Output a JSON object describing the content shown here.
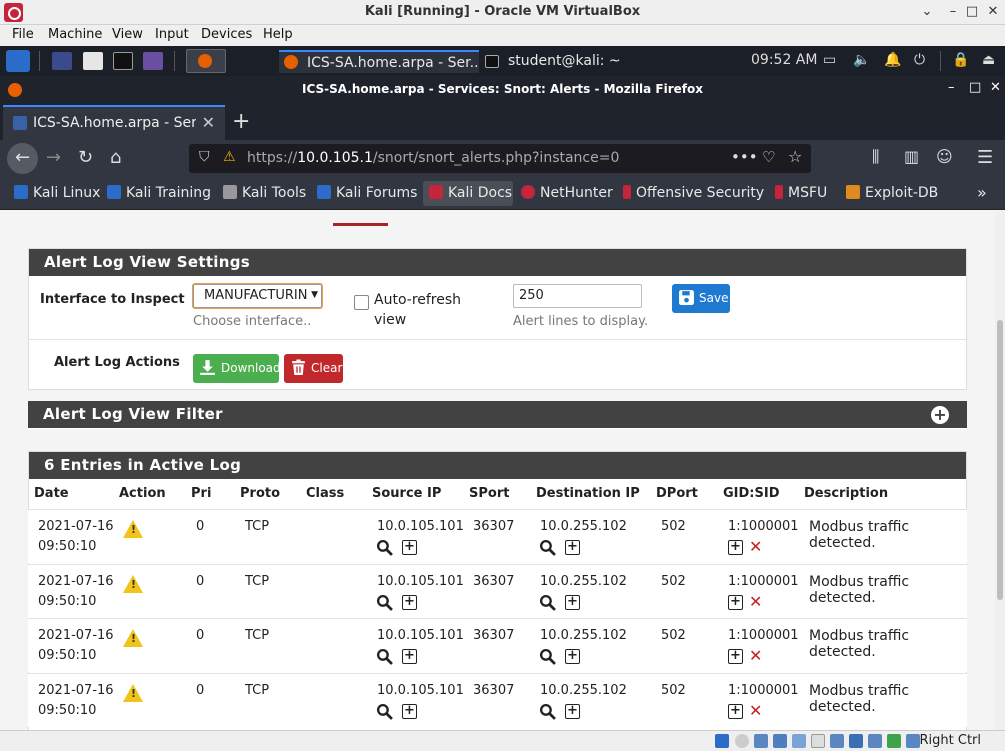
{
  "vbox": {
    "title": "Kali [Running] - Oracle VM VirtualBox",
    "menu": [
      "File",
      "Machine",
      "View",
      "Input",
      "Devices",
      "Help"
    ],
    "status_right": "Right Ctrl"
  },
  "taskbar": {
    "tasks": [
      "ICS-SA.home.arpa - Ser...",
      "student@kali: ~"
    ],
    "clock": "09:52 AM"
  },
  "firefox": {
    "window_title": "ICS-SA.home.arpa - Services: Snort: Alerts - Mozilla Firefox",
    "tab_label": "ICS-SA.home.arpa - Serv",
    "url_prefix": "https://",
    "url_host": "10.0.105.1",
    "url_path": "/snort/snort_alerts.php?instance=0",
    "bookmarks": [
      "Kali Linux",
      "Kali Training",
      "Kali Tools",
      "Kali Forums",
      "Kali Docs",
      "NetHunter",
      "Offensive Security",
      "MSFU",
      "Exploit-DB"
    ]
  },
  "settings": {
    "heading": "Alert Log View Settings",
    "interface_label": "Interface to Inspect",
    "interface_value": "MANUFACTURIN",
    "interface_hint": "Choose interface..",
    "autorefresh_line1": "Auto-refresh",
    "autorefresh_line2": "view",
    "lines_value": "250",
    "lines_hint": "Alert lines to display.",
    "save_label": "Save",
    "actions_label": "Alert Log Actions",
    "download_label": "Download",
    "clear_label": "Clear"
  },
  "filter": {
    "heading": "Alert Log View Filter"
  },
  "log": {
    "heading": "6 Entries in Active Log",
    "columns": [
      "Date",
      "Action",
      "Pri",
      "Proto",
      "Class",
      "Source IP",
      "SPort",
      "Destination IP",
      "DPort",
      "GID:SID",
      "Description"
    ],
    "rows": [
      {
        "date1": "2021-07-16",
        "date2": "09:50:10",
        "pri": "0",
        "proto": "TCP",
        "src": "10.0.105.101",
        "sport": "36307",
        "dst": "10.0.255.102",
        "dport": "502",
        "sid": "1:1000001",
        "desc": "Modbus traffic detected."
      },
      {
        "date1": "2021-07-16",
        "date2": "09:50:10",
        "pri": "0",
        "proto": "TCP",
        "src": "10.0.105.101",
        "sport": "36307",
        "dst": "10.0.255.102",
        "dport": "502",
        "sid": "1:1000001",
        "desc": "Modbus traffic detected."
      },
      {
        "date1": "2021-07-16",
        "date2": "09:50:10",
        "pri": "0",
        "proto": "TCP",
        "src": "10.0.105.101",
        "sport": "36307",
        "dst": "10.0.255.102",
        "dport": "502",
        "sid": "1:1000001",
        "desc": "Modbus traffic detected."
      },
      {
        "date1": "2021-07-16",
        "date2": "09:50:10",
        "pri": "0",
        "proto": "TCP",
        "src": "10.0.105.101",
        "sport": "36307",
        "dst": "10.0.255.102",
        "dport": "502",
        "sid": "1:1000001",
        "desc": "Modbus traffic detected."
      }
    ]
  },
  "colors": {
    "panel_header": "#424242",
    "save_button": "#1e79d0",
    "download_button": "#4bae4f",
    "clear_button": "#c0282b",
    "warning_icon": "#f0c419"
  }
}
